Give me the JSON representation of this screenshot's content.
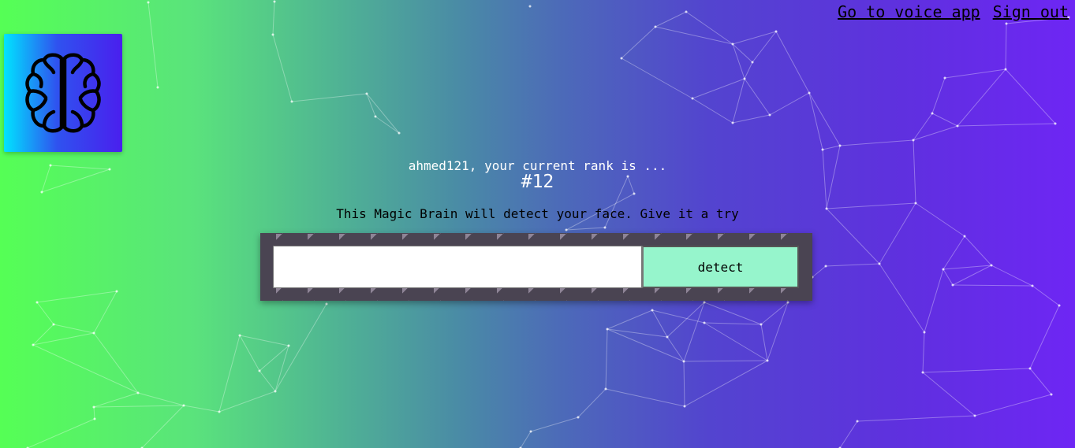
{
  "nav": {
    "voice_app_label": "Go to voice app",
    "sign_out_label": "Sign out"
  },
  "logo": {
    "icon": "brain-icon"
  },
  "rank": {
    "message": "ahmed121, your current rank is ...",
    "value": "#12"
  },
  "tagline": "This Magic Brain will detect your face. Give it a try",
  "form": {
    "url_value": "",
    "detect_label": "detect"
  },
  "colors": {
    "background_start": "#55ff55",
    "background_end": "#6e26f4",
    "logo_start": "#00e4ff",
    "logo_end": "#4a1fee",
    "detect_button": "#96f5cc",
    "panel": "#4a4452"
  }
}
